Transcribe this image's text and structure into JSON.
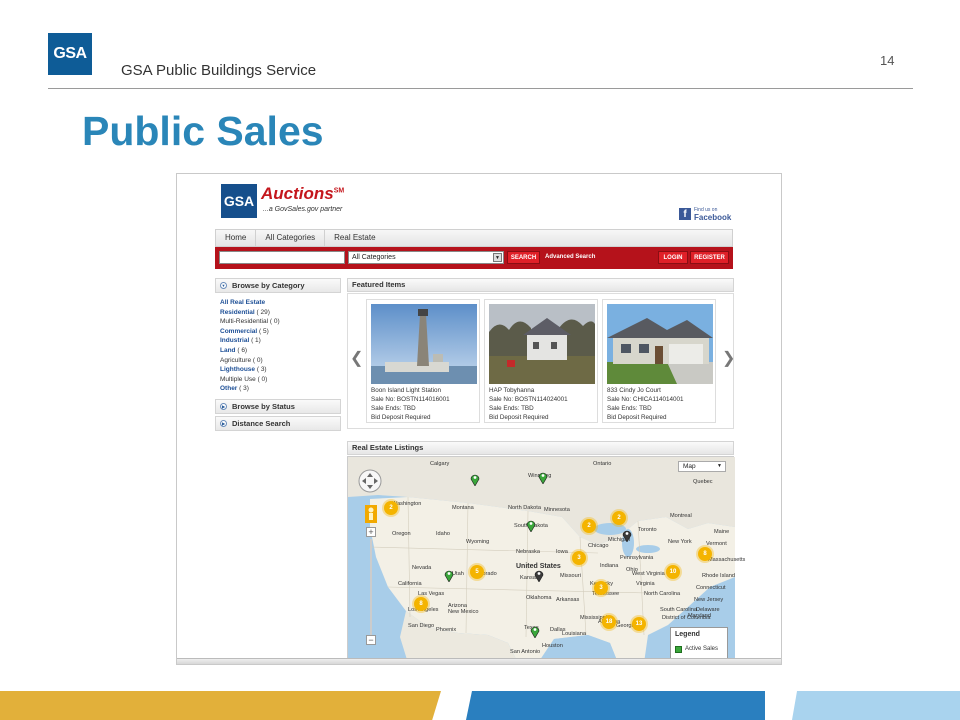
{
  "slide": {
    "logo_text": "GSA",
    "org": "GSA Public Buildings Service",
    "page_number": "14",
    "title": "Public Sales"
  },
  "site": {
    "logo_text": "GSA",
    "brand": "Auctions",
    "brand_mark": "SM",
    "tagline": "...a GovSales.gov partner",
    "facebook_find": "Find us on",
    "facebook_name": "Facebook",
    "nav": [
      "Home",
      "All Categories",
      "Real Estate"
    ],
    "search": {
      "value": "",
      "category": "All Categories",
      "search_btn": "SEARCH",
      "advanced": "Advanced Search",
      "login_btn": "LOGIN",
      "register_btn": "REGISTER"
    }
  },
  "sidebar": {
    "browse_category": "Browse by Category",
    "categories": [
      {
        "label": "All Real Estate",
        "count": "",
        "link": true
      },
      {
        "label": "Residential",
        "count": "( 29)",
        "link": true
      },
      {
        "label": "Multi-Residential",
        "count": "( 0)",
        "link": false
      },
      {
        "label": "Commercial",
        "count": "( 5)",
        "link": true
      },
      {
        "label": "Industrial",
        "count": "( 1)",
        "link": true
      },
      {
        "label": "Land",
        "count": "( 6)",
        "link": true
      },
      {
        "label": "Agriculture",
        "count": "( 0)",
        "link": false
      },
      {
        "label": "Lighthouse",
        "count": "( 3)",
        "link": true
      },
      {
        "label": "Multiple Use",
        "count": "( 0)",
        "link": false
      },
      {
        "label": "Other",
        "count": "( 3)",
        "link": true
      }
    ],
    "browse_status": "Browse by Status",
    "distance_search": "Distance Search"
  },
  "featured": {
    "title": "Featured Items",
    "items": [
      {
        "name": "Boon Island Light Station",
        "sale_no": "Sale No: BOSTN114016001",
        "ends": "Sale Ends: TBD",
        "deposit": "Bid Deposit Required"
      },
      {
        "name": "HAP Tobyhanna",
        "sale_no": "Sale No: BOSTN114024001",
        "ends": "Sale Ends: TBD",
        "deposit": "Bid Deposit Required"
      },
      {
        "name": "833 Cindy Jo Court",
        "sale_no": "Sale No: CHICA114014001",
        "ends": "Sale Ends: TBD",
        "deposit": "Bid Deposit Required"
      }
    ],
    "prev": "❮",
    "next": "❯"
  },
  "listings": {
    "title": "Real Estate Listings",
    "map_type": "Map",
    "legend_title": "Legend",
    "legend_item": "Active Sales",
    "colors": {
      "cluster": "#f4b400",
      "pin_active": "#3aa63a",
      "pin_dark": "#3a3a3a"
    },
    "labels": [
      "Calgary",
      "Winnipeg",
      "Ontario",
      "Quebec",
      "Washington",
      "Montana",
      "North Dakota",
      "Minnesota",
      "Oregon",
      "Idaho",
      "South Dakota",
      "Wyoming",
      "Montreal",
      "Toronto",
      "Michigan",
      "New York",
      "Nebraska",
      "Iowa",
      "Chicago",
      "Pennsylvania",
      "Nevada",
      "United States",
      "Utah",
      "Colorado",
      "Kansas",
      "Missouri",
      "Indiana",
      "Ohio",
      "West Virginia",
      "Virginia",
      "Kentucky",
      "California",
      "Las Vegas",
      "Oklahoma",
      "Arkansas",
      "Tennessee",
      "North Carolina",
      "Arizona",
      "Los Angeles",
      "San Diego",
      "New Mexico",
      "Phoenix",
      "Dallas",
      "Texas",
      "San Antonio",
      "Houston",
      "Louisiana",
      "Georgia",
      "Maine",
      "Vermont",
      "Massachusetts",
      "Rhode Island",
      "Connecticut",
      "New Jersey",
      "Delaware",
      "Maryland",
      "District of Columbia",
      "South Carolina",
      "Mississippi",
      "Alabama"
    ],
    "clusters": [
      "2",
      "2",
      "2",
      "5",
      "3",
      "8",
      "10",
      "8",
      "3",
      "18",
      "13"
    ]
  }
}
